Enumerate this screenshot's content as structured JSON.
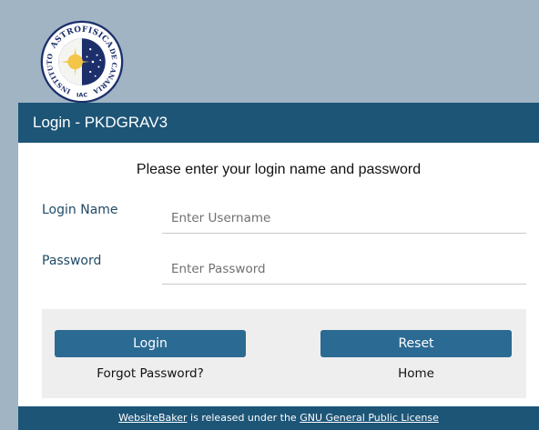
{
  "logo": {
    "top_text": "ASTROFISICA",
    "left_text": "INSTITUTO",
    "right_text": "DE CANARIAS",
    "bottom_text": "IAC"
  },
  "page_title": "Login - PKDGRAV3",
  "intro": "Please enter your login name and password",
  "username": {
    "label": "Login Name",
    "placeholder": "Enter Username",
    "value": ""
  },
  "password": {
    "label": "Password",
    "placeholder": "Enter Password",
    "value": ""
  },
  "buttons": {
    "login": "Login",
    "reset": "Reset"
  },
  "links": {
    "forgot": "Forgot Password?",
    "home": "Home"
  },
  "footer": {
    "link1": "WebsiteBaker",
    "middle": " is released under the ",
    "link2": "GNU General Public License"
  },
  "colors": {
    "background": "#a1b4c4",
    "title_bar": "#1d5577",
    "button": "#2b6a93",
    "label": "#1f4a66"
  }
}
